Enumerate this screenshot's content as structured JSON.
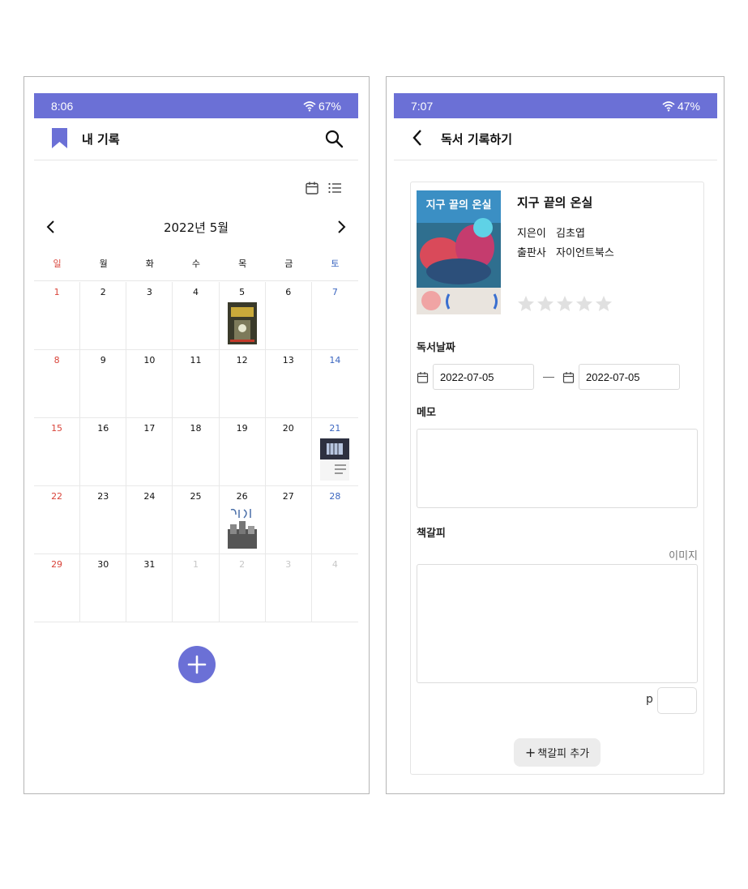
{
  "left": {
    "status": {
      "time": "8:06",
      "battery": "67%"
    },
    "header": {
      "title": "내 기록"
    },
    "calendar": {
      "month_title": "2022년 5월",
      "weekdays": [
        "일",
        "월",
        "화",
        "수",
        "목",
        "금",
        "토"
      ],
      "days": [
        {
          "d": "1",
          "t": "sun"
        },
        {
          "d": "2"
        },
        {
          "d": "3"
        },
        {
          "d": "4"
        },
        {
          "d": "5",
          "book": "horror"
        },
        {
          "d": "6"
        },
        {
          "d": "7",
          "t": "sat"
        },
        {
          "d": "8",
          "t": "sun"
        },
        {
          "d": "9"
        },
        {
          "d": "10"
        },
        {
          "d": "11"
        },
        {
          "d": "12"
        },
        {
          "d": "13"
        },
        {
          "d": "14",
          "t": "sat"
        },
        {
          "d": "15",
          "t": "sun"
        },
        {
          "d": "16"
        },
        {
          "d": "17"
        },
        {
          "d": "18"
        },
        {
          "d": "19"
        },
        {
          "d": "20"
        },
        {
          "d": "21",
          "t": "sat",
          "book": "building"
        },
        {
          "d": "22",
          "t": "sun"
        },
        {
          "d": "23"
        },
        {
          "d": "24"
        },
        {
          "d": "25"
        },
        {
          "d": "26",
          "book": "city"
        },
        {
          "d": "27"
        },
        {
          "d": "28",
          "t": "sat"
        },
        {
          "d": "29",
          "t": "sun"
        },
        {
          "d": "30"
        },
        {
          "d": "31"
        },
        {
          "d": "1",
          "t": "muted"
        },
        {
          "d": "2",
          "t": "muted"
        },
        {
          "d": "3",
          "t": "muted"
        },
        {
          "d": "4",
          "t": "muted"
        }
      ]
    }
  },
  "right": {
    "status": {
      "time": "7:07",
      "battery": "47%"
    },
    "header": {
      "title": "독서 기록하기"
    },
    "book": {
      "title": "지구 끝의 온실",
      "author_label": "지은이",
      "author": "김초엽",
      "publisher_label": "출판사",
      "publisher": "자이언트북스",
      "rating": 0
    },
    "reading_date_label": "독서날짜",
    "start_date": "2022-07-05",
    "end_date": "2022-07-05",
    "memo_label": "메모",
    "bookmark_label": "책갈피",
    "image_label": "이미지",
    "page_label": "p",
    "add_bookmark_label": "책갈피 추가"
  },
  "colors": {
    "accent": "#6b70d6",
    "sunday": "#d9443a",
    "saturday": "#3b66c0"
  }
}
